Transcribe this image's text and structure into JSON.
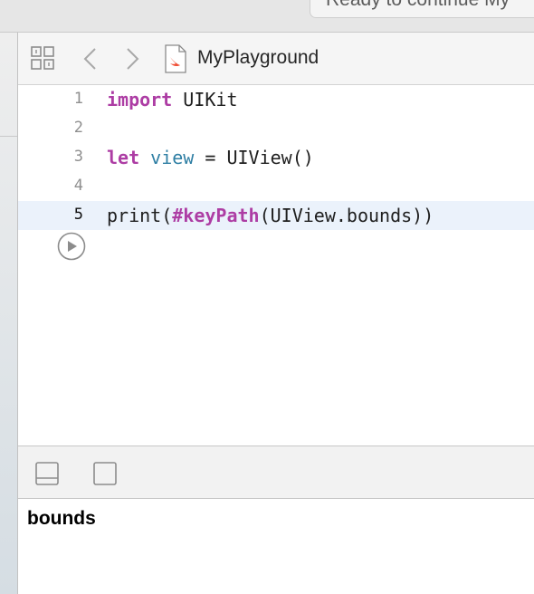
{
  "window": {
    "status_text": "Ready to continue My"
  },
  "navigator": {
    "back_enabled": false,
    "forward_enabled": false,
    "file_icon": "swift-file-icon",
    "file_name": "MyPlayground"
  },
  "editor": {
    "current_line": 5,
    "lines": [
      {
        "number": "1",
        "tokens": [
          {
            "text": "import",
            "kind": "keyword"
          },
          {
            "text": " UIKit",
            "kind": "plain"
          }
        ]
      },
      {
        "number": "2",
        "tokens": []
      },
      {
        "number": "3",
        "tokens": [
          {
            "text": "let",
            "kind": "keyword"
          },
          {
            "text": " ",
            "kind": "plain"
          },
          {
            "text": "view",
            "kind": "declaration"
          },
          {
            "text": " = UIView()",
            "kind": "plain"
          }
        ]
      },
      {
        "number": "4",
        "tokens": []
      },
      {
        "number": "5",
        "tokens": [
          {
            "text": "print(",
            "kind": "plain"
          },
          {
            "text": "#keyPath",
            "kind": "keyword"
          },
          {
            "text": "(UIView.bounds))",
            "kind": "plain"
          }
        ]
      }
    ],
    "run_button_icon": "play-icon"
  },
  "debug_bar": {
    "icons": [
      "hide-debug-area-icon",
      "show-console-icon"
    ]
  },
  "console": {
    "output": "bounds"
  },
  "colors": {
    "keyword": "#ad3da4",
    "declaration": "#2f7fa4",
    "current_line_highlight": "#ebf2fb"
  }
}
